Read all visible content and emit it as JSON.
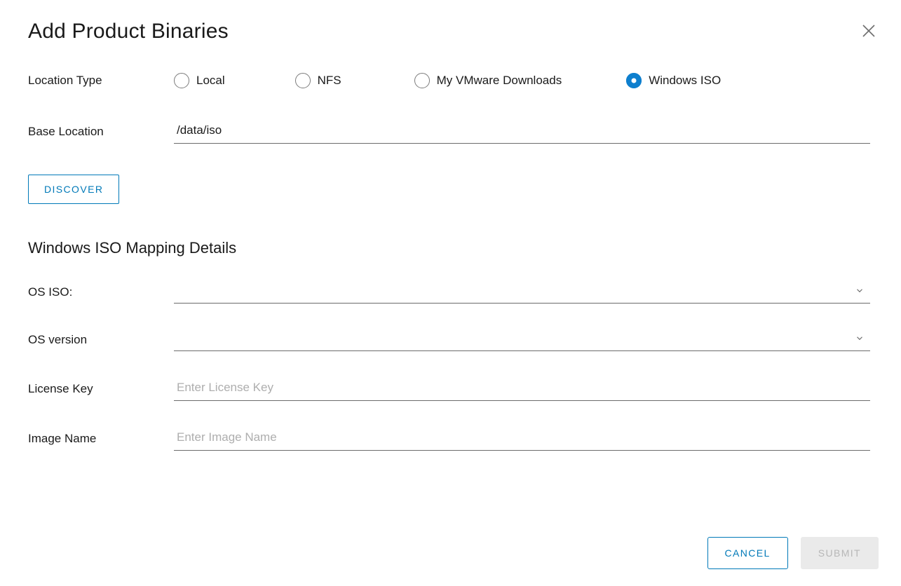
{
  "dialog": {
    "title": "Add Product Binaries"
  },
  "locationType": {
    "label": "Location Type",
    "options": [
      {
        "label": "Local",
        "checked": false
      },
      {
        "label": "NFS",
        "checked": false
      },
      {
        "label": "My VMware Downloads",
        "checked": false
      },
      {
        "label": "Windows ISO",
        "checked": true
      }
    ]
  },
  "baseLocation": {
    "label": "Base Location",
    "value": "/data/iso"
  },
  "discover": {
    "label": "DISCOVER"
  },
  "mapping": {
    "heading": "Windows ISO Mapping Details",
    "osIso": {
      "label": "OS ISO:",
      "value": ""
    },
    "osVersion": {
      "label": "OS version",
      "value": ""
    },
    "licenseKey": {
      "label": "License Key",
      "placeholder": "Enter License Key",
      "value": ""
    },
    "imageName": {
      "label": "Image Name",
      "placeholder": "Enter Image Name",
      "value": ""
    }
  },
  "footer": {
    "cancel": "CANCEL",
    "submit": "SUBMIT"
  }
}
